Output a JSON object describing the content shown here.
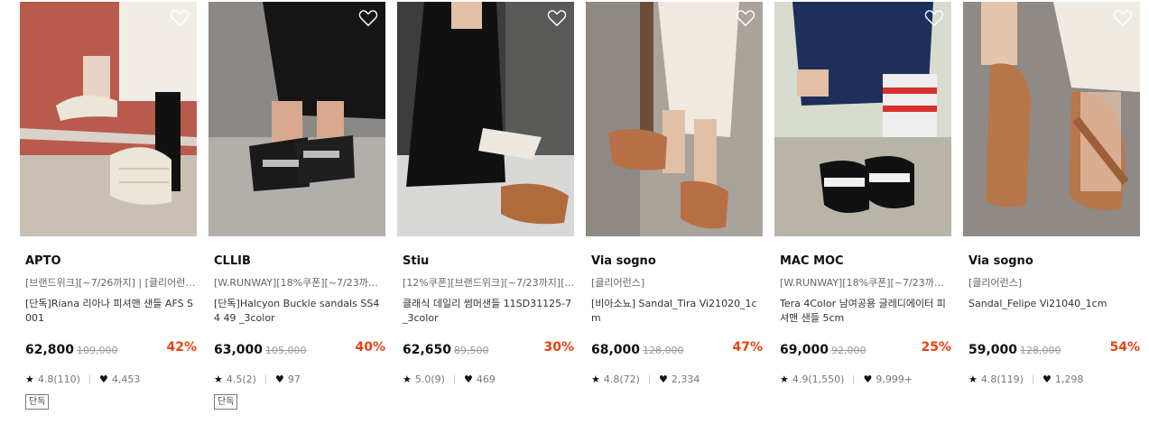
{
  "products": [
    {
      "brand": "APTO",
      "tags": "[브랜드위크][~7/26까지] | [클리어런스]",
      "name": "[단독]Riana 리아나 피셔맨 샌들 AFS S001",
      "price": "62,800",
      "original_price": "109,000",
      "discount": "42%",
      "rating": "4.8(110)",
      "likes": "4,453",
      "badge": "단독",
      "heart_icon": "heart-outline-icon",
      "colors": {
        "bg": "#b85b4c",
        "floor": "#c9c0b5"
      }
    },
    {
      "brand": "CLLIB",
      "tags": "[W.RUNWAY][18%쿠폰][~7/23까지] ...",
      "name": "[단독]Halcyon Buckle sandals SS44 49 _3color",
      "price": "63,000",
      "original_price": "105,000",
      "discount": "40%",
      "rating": "4.5(2)",
      "likes": "97",
      "badge": "단독",
      "heart_icon": "heart-outline-icon",
      "colors": {
        "bg": "#8c8885",
        "floor": "#b2aeaa"
      }
    },
    {
      "brand": "Stiu",
      "tags": "[12%쿠폰][브랜드위크][~7/23까지][...",
      "name": "클래식 데일리 썸머샌들 11SD31125-7 _3color",
      "price": "62,650",
      "original_price": "89,500",
      "discount": "30%",
      "rating": "5.0(9)",
      "likes": "469",
      "badge": "",
      "heart_icon": "heart-outline-icon",
      "colors": {
        "bg": "#3d3d3d",
        "floor": "#d8d8d6"
      }
    },
    {
      "brand": "Via sogno",
      "tags": "[클리어런스]",
      "name": "[비아소뇨] Sandal_Tira Vi21020_1c m",
      "price": "68,000",
      "original_price": "128,000",
      "discount": "47%",
      "rating": "4.8(72)",
      "likes": "2,334",
      "badge": "",
      "heart_icon": "heart-outline-icon",
      "colors": {
        "bg": "#a9a39c",
        "floor": "#8e8982"
      }
    },
    {
      "brand": "MAC MOC",
      "tags": "[W.RUNWAY][18%쿠폰][~7/23까지] ...",
      "name": "Tera 4Color 남여공용 글레디에이터 피셔맨 샌들 5cm",
      "price": "69,000",
      "original_price": "92,000",
      "discount": "25%",
      "rating": "4.9(1,550)",
      "likes": "9,999+",
      "badge": "",
      "heart_icon": "heart-outline-icon",
      "colors": {
        "bg": "#d7dccf",
        "floor": "#b9b4a8"
      }
    },
    {
      "brand": "Via sogno",
      "tags": "[클리어런스]",
      "name": "Sandal_Felipe Vi21040_1cm",
      "price": "59,000",
      "original_price": "128,000",
      "discount": "54%",
      "rating": "4.8(119)",
      "likes": "1,298",
      "badge": "",
      "heart_icon": "heart-outline-icon",
      "colors": {
        "bg": "#8f8a86",
        "floor": "#a19c98"
      }
    }
  ]
}
